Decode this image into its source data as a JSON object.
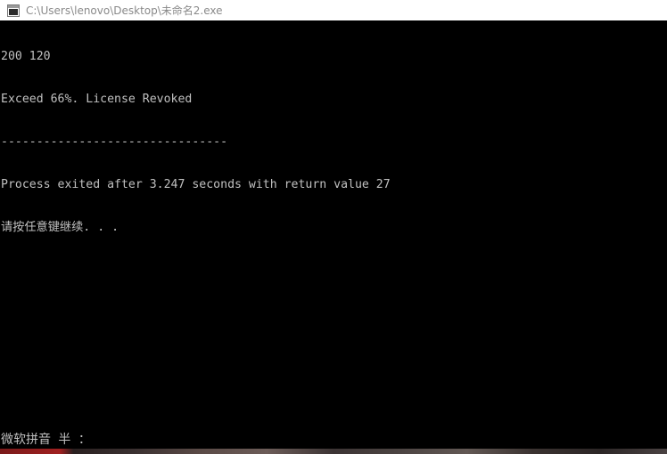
{
  "window": {
    "title": "C:\\Users\\lenovo\\Desktop\\未命名2.exe",
    "icon": "console-app-icon"
  },
  "console": {
    "lines": [
      "200 120",
      "Exceed 66%. License Revoked",
      "--------------------------------",
      "Process exited after 3.247 seconds with return value 27",
      "请按任意键继续. . ."
    ]
  },
  "ime": {
    "status": "微软拼音 半 ："
  },
  "colors": {
    "console_bg": "#000000",
    "console_text": "#c0c0c0",
    "titlebar_bg": "#ffffff",
    "title_text": "#8a8a8a"
  }
}
